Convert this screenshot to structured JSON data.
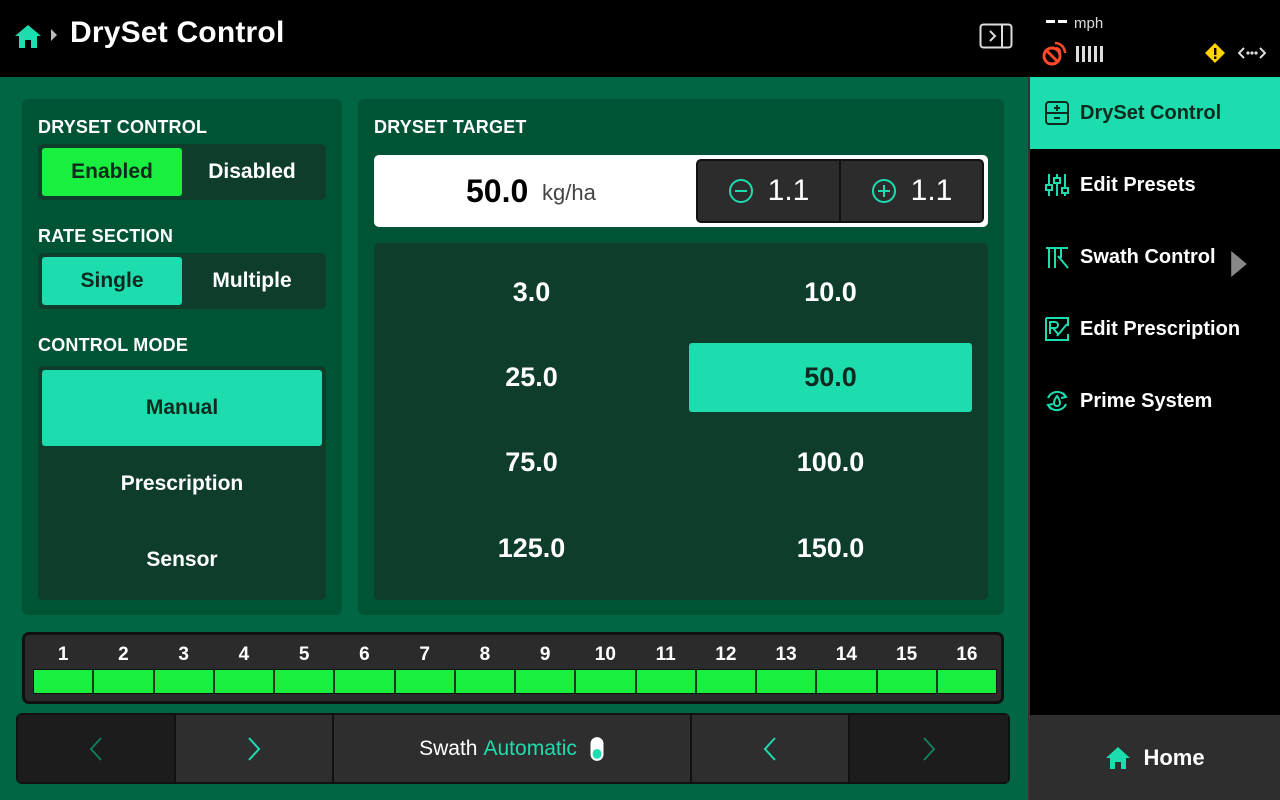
{
  "header": {
    "title": "DrySet Control"
  },
  "status": {
    "speed_unit": "mph"
  },
  "dryset_control": {
    "label": "DRYSET CONTROL",
    "options": [
      "Enabled",
      "Disabled"
    ],
    "selected": "Enabled"
  },
  "rate_section": {
    "label": "RATE SECTION",
    "options": [
      "Single",
      "Multiple"
    ],
    "selected": "Single"
  },
  "control_mode": {
    "label": "CONTROL MODE",
    "options": [
      "Manual",
      "Prescription",
      "Sensor"
    ],
    "selected": "Manual"
  },
  "dryset_target": {
    "label": "DRYSET TARGET",
    "value": "50.0",
    "unit": "kg/ha",
    "decrement_step": "1.1",
    "increment_step": "1.1",
    "presets": [
      "3.0",
      "10.0",
      "25.0",
      "50.0",
      "75.0",
      "100.0",
      "125.0",
      "150.0"
    ],
    "selected_preset": "50.0"
  },
  "sections": {
    "numbers": [
      "1",
      "2",
      "3",
      "4",
      "5",
      "6",
      "7",
      "8",
      "9",
      "10",
      "11",
      "12",
      "13",
      "14",
      "15",
      "16"
    ],
    "state": "all-on",
    "on_color": "#19ef3f"
  },
  "toolbar": {
    "swath_label": "Swath",
    "swath_mode": "Automatic"
  },
  "sidebar": {
    "items": [
      {
        "label": "DrySet Control",
        "icon": "dryset-icon",
        "active": true
      },
      {
        "label": "Edit Presets",
        "icon": "sliders-icon",
        "active": false
      },
      {
        "label": "Swath Control",
        "icon": "swath-icon",
        "active": false
      },
      {
        "label": "Edit Prescription",
        "icon": "prescription-icon",
        "active": false
      },
      {
        "label": "Prime System",
        "icon": "prime-icon",
        "active": false
      }
    ],
    "home_label": "Home"
  },
  "colors": {
    "accent": "#1ddcae",
    "enabled_green": "#19ef3f",
    "background": "#006644",
    "card": "#005436",
    "warning": "#ffd400",
    "gps_alert": "#ff4a2a"
  }
}
